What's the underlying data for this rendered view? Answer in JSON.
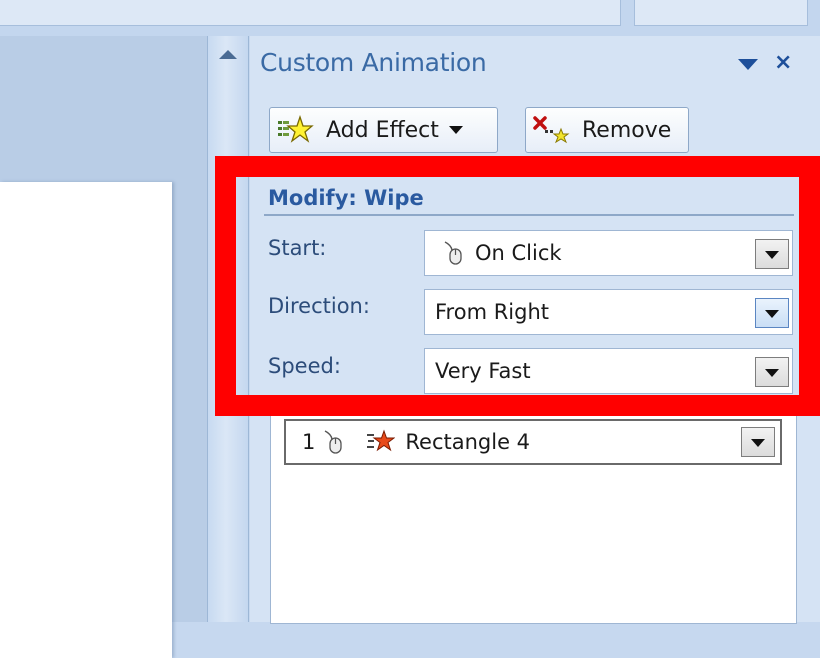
{
  "pane": {
    "title": "Custom Animation",
    "close_glyph": "×"
  },
  "toolbar": {
    "add_effect_label": "Add Effect",
    "add_effect_icon": "add-effect-star-icon",
    "remove_label": "Remove",
    "remove_icon": "remove-effect-icon"
  },
  "modify": {
    "header": "Modify: Wipe",
    "start": {
      "label": "Start:",
      "value": "On Click",
      "icon": "mouse-icon"
    },
    "direction": {
      "label": "Direction:",
      "value": "From Right"
    },
    "speed": {
      "label": "Speed:",
      "value": "Very Fast"
    }
  },
  "effect_list": {
    "items": [
      {
        "number": "1",
        "trigger_icon": "mouse-icon",
        "effect_icon": "entrance-star-icon",
        "label": "Rectangle 4"
      }
    ]
  },
  "colors": {
    "highlight": "#ff0000",
    "pane_title": "#3a6aa5",
    "label_text": "#2c4c7a"
  }
}
